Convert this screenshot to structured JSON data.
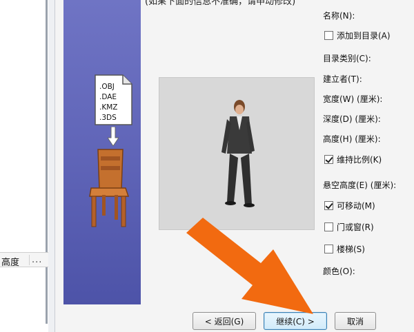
{
  "background_window": {
    "column_header": {
      "height_label": "高度",
      "more_label": "..."
    }
  },
  "dialog": {
    "top_partial_text": "(如果下面的信息不准确，请申动修改)",
    "side_panel": {
      "formats": [
        ".OBJ",
        ".DAE",
        ".KMZ",
        ".3DS"
      ],
      "bar_color": "#6065b8"
    },
    "properties": {
      "name_label": "名称(N):",
      "add_to_catalog_label": "添加到目录(A)",
      "add_to_catalog_checked": false,
      "category_label": "目录类别(C):",
      "creator_label": "建立者(T):",
      "width_label": "宽度(W)  (厘米):",
      "depth_label": "深度(D)  (厘米):",
      "height_label": "高度(H)  (厘米):",
      "keep_ratio_label": "维持比例(K)",
      "keep_ratio_checked": true,
      "elevation_label": "悬空高度(E)  (厘米):",
      "movable_label": "可移动(M)",
      "movable_checked": true,
      "door_window_label": "门或窗(R)",
      "door_window_checked": false,
      "staircase_label": "楼梯(S)",
      "staircase_checked": false,
      "color_label": "颜色(O):"
    },
    "buttons": {
      "back": "< 返回(G)",
      "continue": "继续(C) >",
      "cancel": "取消"
    },
    "annotation": {
      "arrow_color": "#f26a10",
      "arrow_icon": "arrow-pointer"
    }
  }
}
